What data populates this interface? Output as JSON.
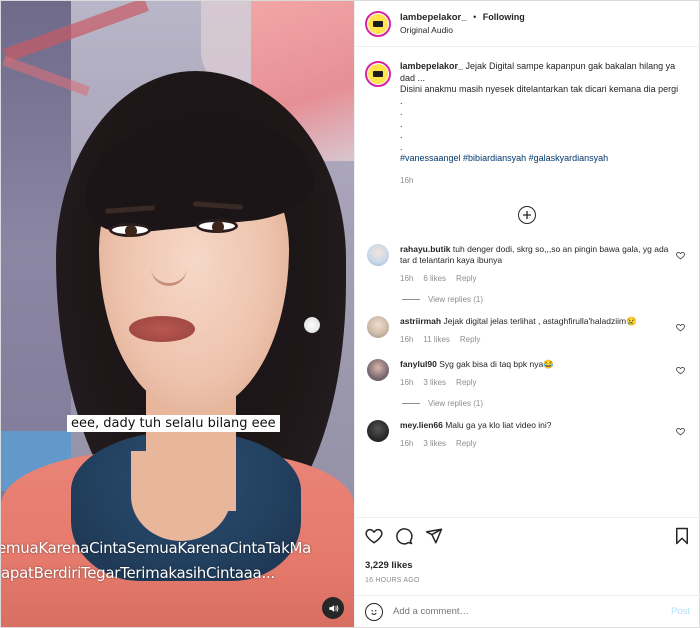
{
  "header": {
    "username": "lambepelakor_",
    "separator": "•",
    "follow_label": "Following",
    "audio": "Original Audio"
  },
  "video": {
    "caption_text": "eee, dady tuh selalu bilang eee",
    "ticker_line1": "emuaKarenaCintaSemuaKarenaCintaTakMa",
    "ticker_line2": "apatBerdiriTegarTerimakasihCintaaa...",
    "mute_icon": "speaker-icon"
  },
  "post": {
    "username": "lambepelakor_",
    "text1": "Jejak Digital sampe kapanpun gak bakalan hilang ya dad ...",
    "text2": "Disini anakmu masih nyesek ditelantarkan tak dicari kemana dia pergi",
    "dots": [
      ".",
      ".",
      ".",
      ".",
      "."
    ],
    "hashtags": "#vanessaangel #bibiardiansyah #galaskyardiansyah",
    "time": "16h"
  },
  "comments": [
    {
      "username": "rahayu.butik",
      "text": "tuh denger dodi, skrg so,,,so an pingin bawa gala, yg ada tar d telantarin kaya ibunya",
      "time": "16h",
      "likes": "6 likes",
      "reply": "Reply",
      "view_replies": "View replies (1)",
      "avatar_color": "#c7d7e8"
    },
    {
      "username": "astriirmah",
      "text": "Jejak digital jelas terlihat , astaghfirulla'haladziim😢",
      "time": "16h",
      "likes": "11 likes",
      "reply": "Reply",
      "view_replies": "",
      "avatar_color": "#cdbba9"
    },
    {
      "username": "fanylul90",
      "text": "Syg gak bisa di taq bpk nya😂",
      "time": "16h",
      "likes": "3 likes",
      "reply": "Reply",
      "view_replies": "View replies (1)",
      "avatar_color": "#7b6a73"
    },
    {
      "username": "mey.lien66",
      "text": "Malu ga ya klo liat video ini?",
      "time": "16h",
      "likes": "3 likes",
      "reply": "Reply",
      "view_replies": "",
      "avatar_color": "#2a2a2a"
    }
  ],
  "actions": {
    "likes": "3,229 likes",
    "ago": "16 HOURS AGO"
  },
  "add_comment": {
    "placeholder": "Add a comment…",
    "post_label": "Post"
  }
}
